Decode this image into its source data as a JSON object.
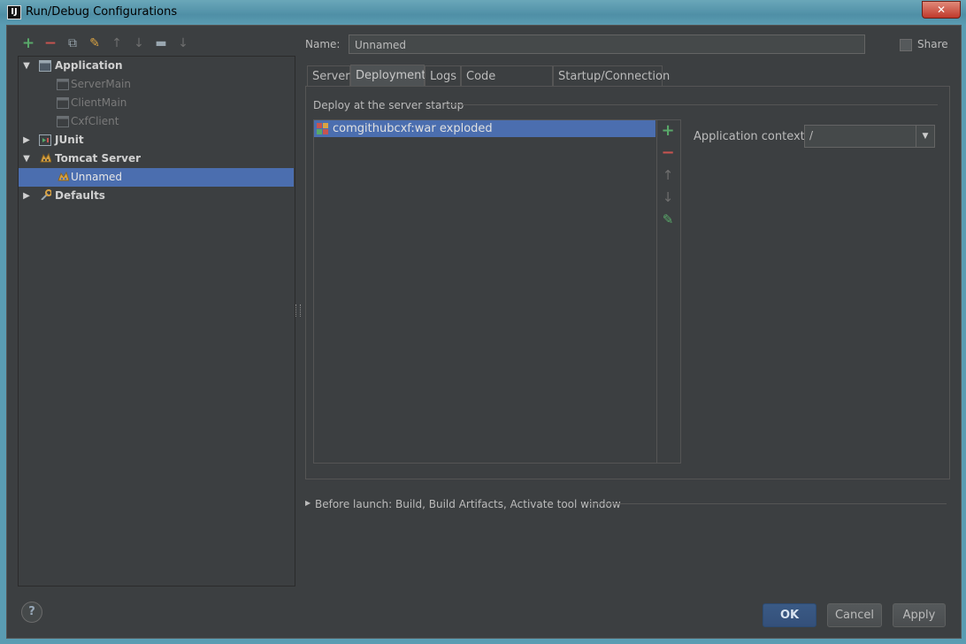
{
  "window": {
    "title": "Run/Debug Configurations",
    "app_icon": "intellij-icon",
    "close_label": "✕"
  },
  "toolbar": {
    "icons": [
      "add-icon",
      "remove-icon",
      "copy-icon",
      "edit-defaults-icon",
      "move-up-icon",
      "move-down-icon",
      "folder-icon",
      "sort-icon"
    ],
    "glyphs": [
      "+",
      "−",
      "⧉",
      "✎",
      "↑",
      "↓",
      "▬",
      "↓"
    ],
    "colors": {
      "add": "#59a869",
      "remove": "#c75450"
    }
  },
  "tree": {
    "items": [
      {
        "label": "Application",
        "level": 0,
        "expanded": true,
        "bold": true,
        "icon": "application-icon"
      },
      {
        "label": "ServerMain",
        "level": 1,
        "dim": true,
        "icon": "application-config-icon"
      },
      {
        "label": "ClientMain",
        "level": 1,
        "dim": true,
        "icon": "application-config-icon"
      },
      {
        "label": "CxfClient",
        "level": 1,
        "dim": true,
        "icon": "application-config-icon"
      },
      {
        "label": "JUnit",
        "level": 0,
        "expanded": false,
        "bold": true,
        "icon": "junit-icon"
      },
      {
        "label": "Tomcat Server",
        "level": 0,
        "expanded": true,
        "bold": true,
        "icon": "tomcat-icon"
      },
      {
        "label": "Unnamed",
        "level": 1,
        "selected": true,
        "icon": "tomcat-icon"
      },
      {
        "label": "Defaults",
        "level": 0,
        "expanded": false,
        "bold": true,
        "icon": "defaults-icon"
      }
    ]
  },
  "form": {
    "name_label": "Name:",
    "name_value": "Unnamed",
    "share_label": "Share",
    "share_checked": false
  },
  "tabs": [
    {
      "label": "Server",
      "active": false
    },
    {
      "label": "Deployment",
      "active": true
    },
    {
      "label": "Logs",
      "active": false
    },
    {
      "label": "Code Coverage",
      "active": false
    },
    {
      "label": "Startup/Connection",
      "active": false
    }
  ],
  "deployment": {
    "group_title": "Deploy at the server startup",
    "artifacts": [
      "comgithubcxf:war exploded"
    ],
    "side_buttons": [
      "add-icon",
      "remove-icon",
      "move-up-icon",
      "move-down-icon",
      "edit-icon"
    ],
    "context_label": "Application context:",
    "context_value": "/"
  },
  "before_launch": {
    "label": "Before launch: Build, Build Artifacts, Activate tool window"
  },
  "buttons": {
    "ok": "OK",
    "cancel": "Cancel",
    "apply": "Apply",
    "help": "?"
  },
  "colors": {
    "background": "#3c3f41",
    "selection": "#4b6eaf",
    "ok_button": "#365880"
  }
}
